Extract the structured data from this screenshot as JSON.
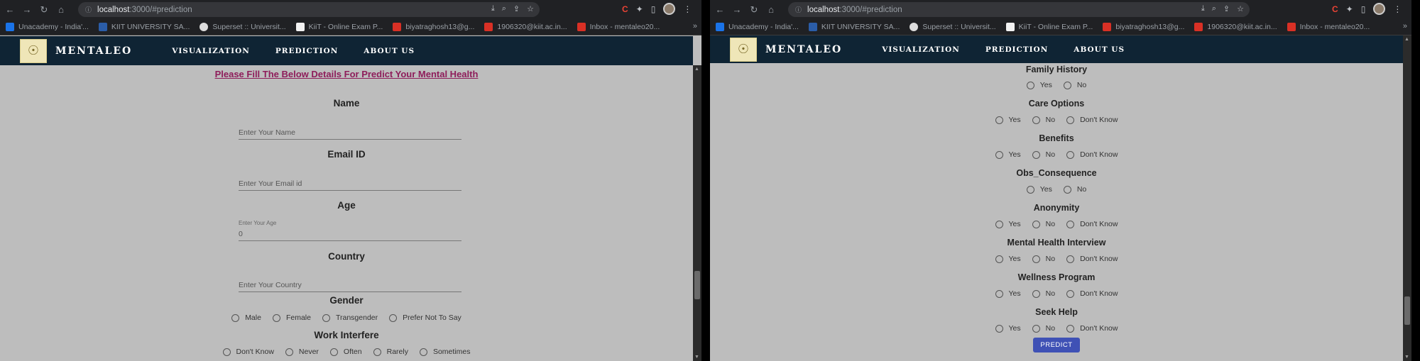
{
  "left_window": {
    "url_host": "localhost",
    "url_path": ":3000/#prediction",
    "bookmarks": [
      "Unacademy - India'...",
      "KIIT UNIVERSITY SA...",
      "Superset :: Universit...",
      "KiiT - Online Exam P...",
      "biyatraghosh13@g...",
      "1906320@kiit.ac.in...",
      "Inbox - mentaleo20..."
    ],
    "heading": "Please Fill The Below Details For Predict Your Mental Health",
    "name_label": "Name",
    "name_placeholder": "Enter Your Name",
    "email_label": "Email ID",
    "email_placeholder": "Enter Your Email id",
    "age_label": "Age",
    "age_small": "Enter Your Age",
    "age_value": "0",
    "country_label": "Country",
    "country_placeholder": "Enter Your Country",
    "gender_label": "Gender",
    "gender_options": [
      "Male",
      "Female",
      "Transgender",
      "Prefer Not To Say"
    ],
    "work_label": "Work Interfere",
    "work_options": [
      "Don't Know",
      "Never",
      "Often",
      "Rarely",
      "Sometimes"
    ]
  },
  "right_window": {
    "url_host": "localhost",
    "url_path": ":3000/#prediction",
    "bookmarks": [
      "Unacademy - India'...",
      "KIIT UNIVERSITY SA...",
      "Superset :: Universit...",
      "KiiT - Online Exam P...",
      "biyatraghosh13@g...",
      "1906320@kiit.ac.in...",
      "Inbox - mentaleo20..."
    ],
    "questions": [
      {
        "label": "Family History",
        "options": [
          "Yes",
          "No"
        ]
      },
      {
        "label": "Care Options",
        "options": [
          "Yes",
          "No",
          "Don't Know"
        ]
      },
      {
        "label": "Benefits",
        "options": [
          "Yes",
          "No",
          "Don't Know"
        ]
      },
      {
        "label": "Obs_Consequence",
        "options": [
          "Yes",
          "No"
        ]
      },
      {
        "label": "Anonymity",
        "options": [
          "Yes",
          "No",
          "Don't Know"
        ]
      },
      {
        "label": "Mental Health Interview",
        "options": [
          "Yes",
          "No",
          "Don't Know"
        ]
      },
      {
        "label": "Wellness Program",
        "options": [
          "Yes",
          "No",
          "Don't Know"
        ]
      },
      {
        "label": "Seek Help",
        "options": [
          "Yes",
          "No",
          "Don't Know"
        ]
      }
    ],
    "predict_label": "PREDICT"
  },
  "nav": {
    "brand": "MENTALEO",
    "links": [
      "VISUALIZATION",
      "PREDICTION",
      "ABOUT US"
    ]
  },
  "colors": {
    "navbar": "#0f2434",
    "heading": "#8e1d5a",
    "button": "#3f51b5",
    "page_bg": "#bdbdbd"
  }
}
